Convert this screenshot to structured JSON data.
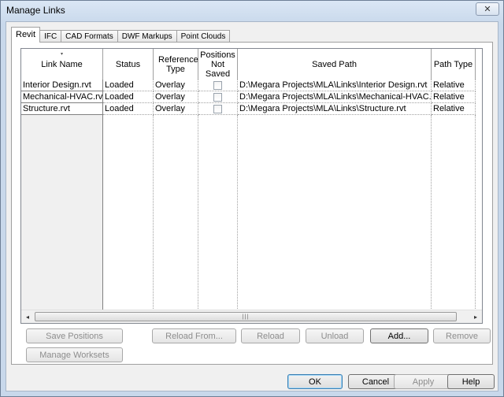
{
  "window": {
    "title": "Manage Links",
    "close_glyph": "✕"
  },
  "tabs": [
    {
      "label": "Revit",
      "active": true
    },
    {
      "label": "IFC",
      "active": false
    },
    {
      "label": "CAD Formats",
      "active": false
    },
    {
      "label": "DWF Markups",
      "active": false
    },
    {
      "label": "Point Clouds",
      "active": false
    }
  ],
  "grid": {
    "columns": [
      {
        "label": "Link Name",
        "sorted": true
      },
      {
        "label": "Status"
      },
      {
        "label": "Reference Type"
      },
      {
        "label": "Positions Not Saved"
      },
      {
        "label": "Saved Path"
      },
      {
        "label": "Path Type"
      }
    ],
    "sort_glyph": "▾",
    "rows": [
      {
        "name": "Interior Design.rvt",
        "status": "Loaded",
        "ref_type": "Overlay",
        "pos_not_saved": false,
        "saved_path": "D:\\Megara Projects\\MLA\\Links\\Interior Design.rvt",
        "path_type": "Relative"
      },
      {
        "name": "Mechanical-HVAC.rvt",
        "status": "Loaded",
        "ref_type": "Overlay",
        "pos_not_saved": false,
        "saved_path": "D:\\Megara Projects\\MLA\\Links\\Mechanical-HVAC.rvt",
        "path_type": "Relative"
      },
      {
        "name": "Structure.rvt",
        "status": "Loaded",
        "ref_type": "Overlay",
        "pos_not_saved": false,
        "saved_path": "D:\\Megara Projects\\MLA\\Links\\Structure.rvt",
        "path_type": "Relative"
      }
    ],
    "scrollbar": {
      "left_glyph": "◂",
      "right_glyph": "▸",
      "thumb_grip": "|||"
    }
  },
  "actions": {
    "save_positions": "Save Positions",
    "manage_worksets": "Manage Worksets",
    "reload_from": "Reload From...",
    "reload": "Reload",
    "unload": "Unload",
    "add": "Add...",
    "remove": "Remove"
  },
  "footer": {
    "ok": "OK",
    "cancel": "Cancel",
    "apply": "Apply",
    "help": "Help"
  }
}
